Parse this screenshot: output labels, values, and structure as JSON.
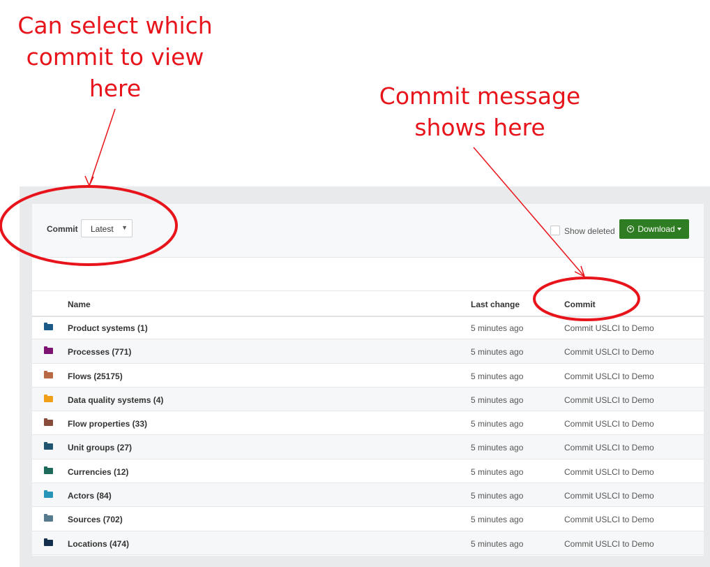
{
  "annotations": {
    "left": [
      "Can select which",
      "commit to view",
      "here"
    ],
    "right": [
      "Commit message",
      "shows here"
    ],
    "color": "#e8141b"
  },
  "toolbar": {
    "commit_label": "Commit",
    "commit_value": "Latest",
    "show_deleted_label": "Show deleted",
    "download_label": "Download",
    "download_color": "#2e7d22"
  },
  "table": {
    "columns": {
      "name": "Name",
      "last_change": "Last change",
      "commit": "Commit"
    },
    "rows": [
      {
        "name": "Product systems (1)",
        "last_change": "5 minutes ago",
        "commit": "Commit USLCI to Demo",
        "color": "#1b5a87"
      },
      {
        "name": "Processes (771)",
        "last_change": "5 minutes ago",
        "commit": "Commit USLCI to Demo",
        "color": "#7d1474"
      },
      {
        "name": "Flows (25175)",
        "last_change": "5 minutes ago",
        "commit": "Commit USLCI to Demo",
        "color": "#b86a45"
      },
      {
        "name": "Data quality systems (4)",
        "last_change": "5 minutes ago",
        "commit": "Commit USLCI to Demo",
        "color": "#f0a018"
      },
      {
        "name": "Flow properties (33)",
        "last_change": "5 minutes ago",
        "commit": "Commit USLCI to Demo",
        "color": "#8a4c3a"
      },
      {
        "name": "Unit groups (27)",
        "last_change": "5 minutes ago",
        "commit": "Commit USLCI to Demo",
        "color": "#1f5470"
      },
      {
        "name": "Currencies (12)",
        "last_change": "5 minutes ago",
        "commit": "Commit USLCI to Demo",
        "color": "#1e6a5a"
      },
      {
        "name": "Actors (84)",
        "last_change": "5 minutes ago",
        "commit": "Commit USLCI to Demo",
        "color": "#2595b8"
      },
      {
        "name": "Sources (702)",
        "last_change": "5 minutes ago",
        "commit": "Commit USLCI to Demo",
        "color": "#567a8e"
      },
      {
        "name": "Locations (474)",
        "last_change": "5 minutes ago",
        "commit": "Commit USLCI to Demo",
        "color": "#142e4d"
      }
    ]
  }
}
